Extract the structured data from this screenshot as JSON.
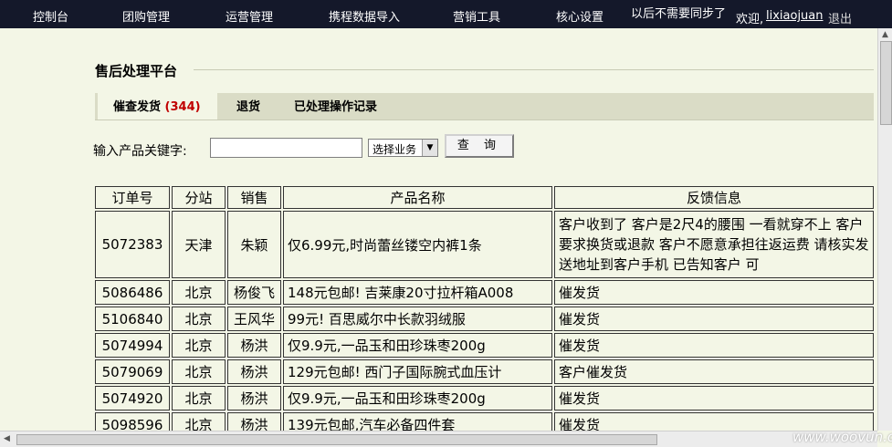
{
  "nav": {
    "items": [
      "控制台",
      "团购管理",
      "运营管理",
      "携程数据导入",
      "营销工具",
      "核心设置"
    ],
    "notice": "以后不需要同步了",
    "welcome": "欢迎,",
    "username": "lixiaojuan",
    "logout": "退出"
  },
  "page": {
    "title": "售后处理平台"
  },
  "tabs": {
    "urge_label": "催查发货",
    "urge_count": "(344)",
    "return_label": "退货",
    "history_label": "已处理操作记录"
  },
  "search": {
    "label": "输入产品关键字:",
    "value": "",
    "select_value": "选择业务",
    "button_label": "查 询"
  },
  "table": {
    "headers": [
      "订单号",
      "分站",
      "销售",
      "产品名称",
      "反馈信息"
    ],
    "rows": [
      {
        "id": "5072383",
        "site": "天津",
        "sales": "朱颖",
        "product": "仅6.99元,时尚蕾丝镂空内裤1条",
        "feedback": " 客户收到了 客户是2尺4的腰围 一看就穿不上 客户要求换货或退款 客户不愿意承担往返运费 请核实发送地址到客户手机 已告知客户 可"
      },
      {
        "id": "5086486",
        "site": "北京",
        "sales": "杨俊飞",
        "product": "148元包邮! 吉莱康20寸拉杆箱A008",
        "feedback": " 催发货"
      },
      {
        "id": "5106840",
        "site": "北京",
        "sales": "王风华",
        "product": "99元! 百思威尔中长款羽绒服",
        "feedback": " 催发货"
      },
      {
        "id": "5074994",
        "site": "北京",
        "sales": "杨洪",
        "product": "仅9.9元,一品玉和田珍珠枣200g",
        "feedback": " 催发货"
      },
      {
        "id": "5079069",
        "site": "北京",
        "sales": "杨洪",
        "product": "129元包邮! 西门子国际腕式血压计",
        "feedback": " 客户催发货"
      },
      {
        "id": "5074920",
        "site": "北京",
        "sales": "杨洪",
        "product": "仅9.9元,一品玉和田珍珠枣200g",
        "feedback": " 催发货"
      },
      {
        "id": "5098596",
        "site": "北京",
        "sales": "杨洪",
        "product": "139元包邮,汽车必备四件套",
        "feedback": " 催发货"
      }
    ]
  },
  "watermark": "www.woovun.org"
}
